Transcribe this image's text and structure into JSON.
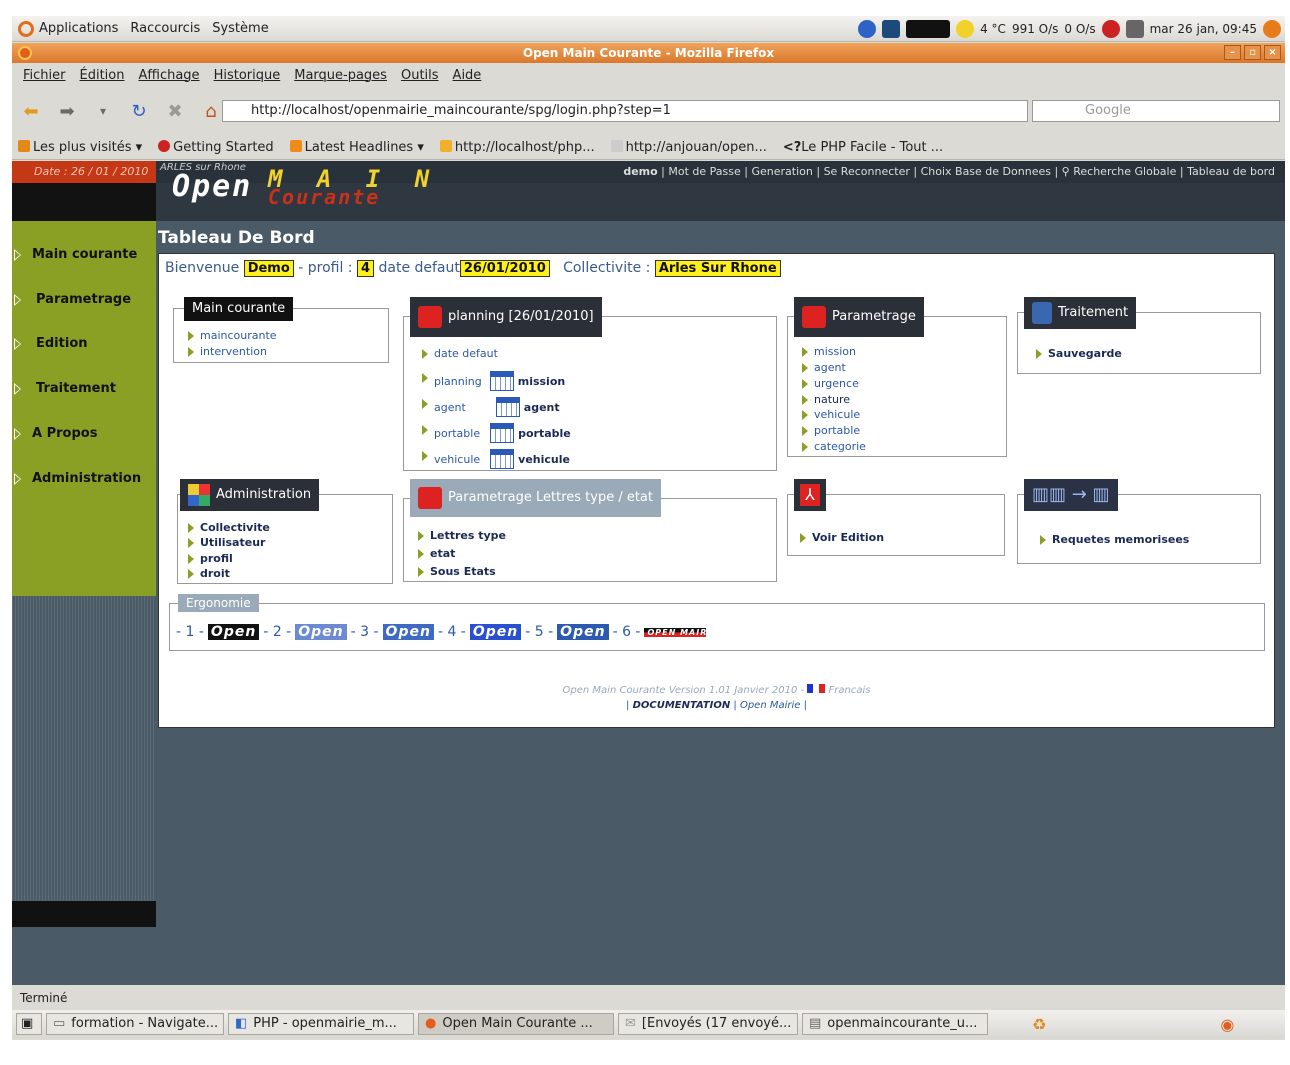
{
  "panel": {
    "applications": "Applications",
    "raccourcis": "Raccourcis",
    "systeme": "Système",
    "weather": "4 °C",
    "net_down": "991 O/s",
    "net_up": "0 O/s",
    "clock": "mar 26 jan, 09:45"
  },
  "browser": {
    "title": "Open Main Courante - Mozilla Firefox",
    "menu": [
      "Fichier",
      "Édition",
      "Affichage",
      "Historique",
      "Marque-pages",
      "Outils",
      "Aide"
    ],
    "url": "http://localhost/openmairie_maincourante/spg/login.php?step=1",
    "search_placeholder": "Google",
    "bookmarks": [
      "Les plus visités",
      "Getting Started",
      "Latest Headlines",
      "http://localhost/php...",
      "http://anjouan/open...",
      "Le PHP Facile - Tout ..."
    ],
    "status": "Terminé"
  },
  "app": {
    "date": "Date : 26 / 01 / 2010",
    "ville": "ARLES sur Rhone",
    "logo_open": "Open",
    "logo_main": "M A I N",
    "logo_courante": "Courante",
    "header_links": [
      "demo",
      "Mot de Passe",
      "Generation",
      "Se Reconnecter",
      "Choix Base de Donnees",
      "Recherche Globale",
      "Tableau de bord"
    ],
    "sidebar": [
      "Main courante",
      "Parametrage",
      "Edition",
      "Traitement",
      "A Propos",
      "Administration"
    ],
    "page_title": "Tableau De Bord",
    "welcome": {
      "bienvenue": "Bienvenue",
      "user": "Demo",
      "profil_label": "- profil :",
      "profil": "4",
      "date_label": "date defaut",
      "date": "26/01/2010",
      "coll_label": "Collectivite :",
      "coll": "Arles Sur Rhone"
    },
    "boxes": {
      "maincourante": {
        "title": "Main courante",
        "links": [
          "maincourante",
          "intervention"
        ]
      },
      "planning": {
        "title": "planning [26/01/2010]",
        "links": [
          "date defaut",
          "planning",
          "agent",
          "portable",
          "vehicule"
        ],
        "icons": [
          "mission",
          "agent",
          "portable",
          "vehicule"
        ]
      },
      "parametrage": {
        "title": "Parametrage",
        "links": [
          "mission",
          "agent",
          "urgence",
          "nature",
          "vehicule",
          "portable",
          "categorie"
        ]
      },
      "traitement": {
        "title": "Traitement",
        "links": [
          "Sauvegarde"
        ]
      },
      "administration": {
        "title": "Administration",
        "links": [
          "Collectivite",
          "Utilisateur",
          "profil",
          "droit"
        ]
      },
      "lettres": {
        "title": "Parametrage Lettres type / etat",
        "links": [
          "Lettres type",
          "etat",
          "Sous Etats"
        ]
      },
      "edition": {
        "links": [
          "Voir Edition"
        ]
      },
      "requetes": {
        "links": [
          "Requetes memorisees"
        ]
      }
    },
    "ergonomie": {
      "title": "Ergonomie",
      "items": [
        "- 1 -",
        "- 2 -",
        "- 3 -",
        "- 4 -",
        "- 5 -",
        "- 6 -"
      ],
      "open": "Open",
      "openmairie": "OPEN MAIRIE"
    },
    "footer": {
      "line1": "Open Main Courante  Version 1.01 Janvier 2010 -",
      "lang": "Francais",
      "doc": "DOCUMENTATION",
      "om": "Open Mairie"
    }
  },
  "taskbar": [
    "formation - Navigate...",
    "PHP - openmairie_m...",
    "Open Main Courante ...",
    "[Envoyés (17 envoyé...",
    "openmaincourante_u..."
  ]
}
